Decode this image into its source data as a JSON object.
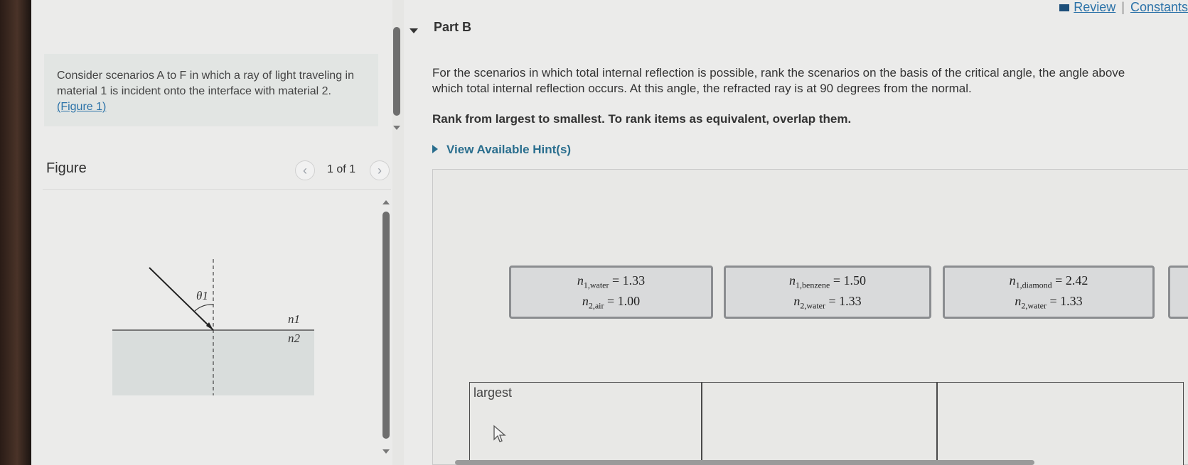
{
  "problem": {
    "text": "Consider scenarios A to F in which a ray of light traveling in material 1 is incident onto the interface with material 2.",
    "figure_link": "(Figure 1)"
  },
  "figure": {
    "label": "Figure",
    "counter": "1 of 1",
    "prev_icon": "chevron-left-icon",
    "next_icon": "chevron-right-icon",
    "diagram": {
      "angle_label": "θ1",
      "n1_label": "n1",
      "n2_label": "n2"
    }
  },
  "top_links": {
    "review": "Review",
    "separator": "|",
    "constants": "Constants"
  },
  "part": {
    "title": "Part B"
  },
  "question": {
    "text": "For the scenarios in which total internal reflection is possible, rank the scenarios on the basis of the critical angle, the angle above which total internal reflection occurs. At this angle, the refracted ray is at 90 degrees from the normal.",
    "instruction": "Rank from largest to smallest. To rank items as equivalent, overlap them.",
    "hints": "View Available Hint(s)"
  },
  "cards": [
    {
      "n1_sym": "n",
      "n1_sub": "1,water",
      "n1_val": "= 1.33",
      "n2_sym": "n",
      "n2_sub": "2,air",
      "n2_val": "= 1.00"
    },
    {
      "n1_sym": "n",
      "n1_sub": "1,benzene",
      "n1_val": "= 1.50",
      "n2_sym": "n",
      "n2_sub": "2,water",
      "n2_val": "= 1.33"
    },
    {
      "n1_sym": "n",
      "n1_sub": "1,diamond",
      "n1_val": "= 2.42",
      "n2_sym": "n",
      "n2_sub": "2,water",
      "n2_val": "= 1.33"
    }
  ],
  "ranking": {
    "largest_label": "largest"
  },
  "colors": {
    "link": "#2b72a8",
    "hint": "#2a6e8e",
    "card_border": "#8b8d90"
  }
}
